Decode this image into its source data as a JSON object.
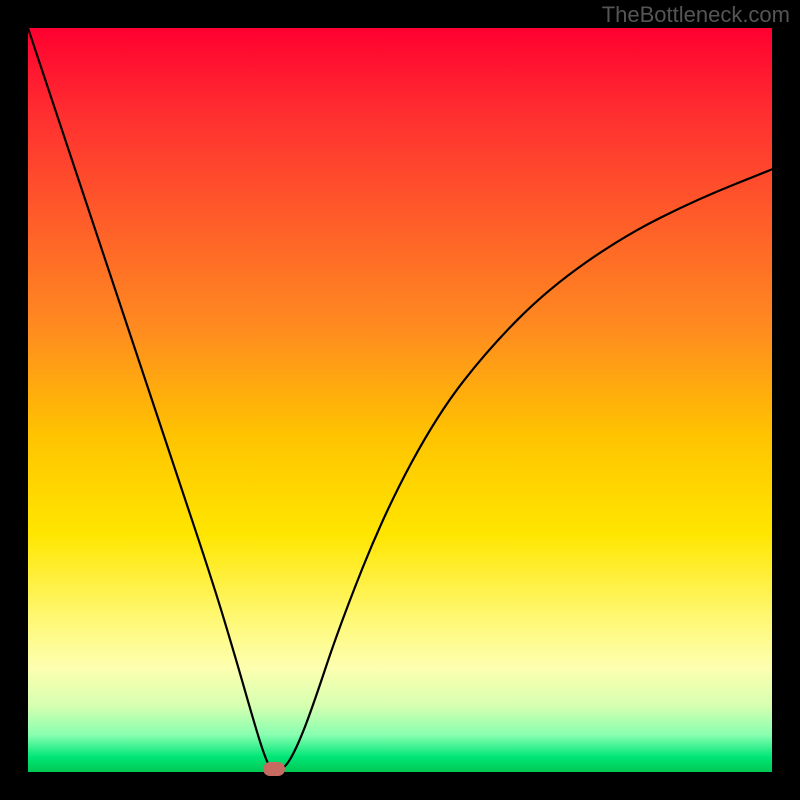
{
  "watermark": "TheBottleneck.com",
  "chart_data": {
    "type": "line",
    "title": "",
    "xlabel": "",
    "ylabel": "",
    "xlim": [
      0,
      100
    ],
    "ylim": [
      0,
      100
    ],
    "series": [
      {
        "name": "curve",
        "x": [
          0,
          5,
          10,
          15,
          20,
          25,
          28,
          30,
          31.5,
          32.5,
          33.5,
          34.5,
          36,
          38,
          42,
          48,
          55,
          62,
          70,
          80,
          90,
          100
        ],
        "values": [
          100,
          85,
          70,
          55,
          40,
          25,
          15,
          8,
          3,
          0.5,
          0.5,
          0.5,
          3,
          8,
          20,
          35,
          48,
          57,
          65,
          72,
          77,
          81
        ]
      }
    ],
    "marker": {
      "x": 33,
      "y": 0.4
    },
    "background_gradient": [
      "#ff0030",
      "#ffe600",
      "#00c853"
    ]
  }
}
